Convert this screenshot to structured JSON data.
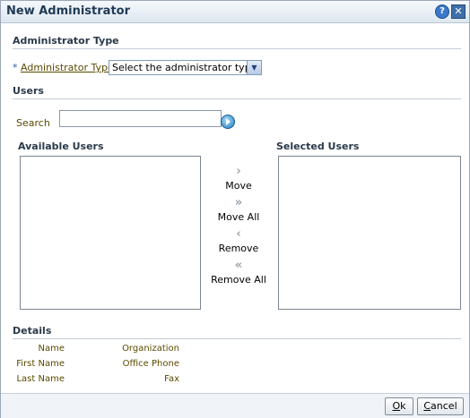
{
  "window": {
    "title": "New Administrator",
    "help_label": "?",
    "close_label": "✕"
  },
  "admin_type": {
    "header": "Administrator Type",
    "required_marker": "*",
    "field_label": "Administrator Type",
    "selected_value": "Select the administrator type"
  },
  "users": {
    "header": "Users",
    "search_label": "Search",
    "search_value": "",
    "available_header": "Available Users",
    "selected_header": "Selected Users",
    "available_items": [],
    "selected_items": []
  },
  "shuttle": {
    "move_label": "Move",
    "move_all_label": "Move All",
    "remove_label": "Remove",
    "remove_all_label": "Remove All",
    "move_icon": "›",
    "move_all_icon": "»",
    "remove_icon": "‹",
    "remove_all_icon": "«"
  },
  "details": {
    "header": "Details",
    "name_label": "Name",
    "first_name_label": "First Name",
    "last_name_label": "Last Name",
    "organization_label": "Organization",
    "office_phone_label": "Office Phone",
    "fax_label": "Fax"
  },
  "footer": {
    "ok_first": "O",
    "ok_rest": "k",
    "cancel_first": "C",
    "cancel_rest": "ancel"
  }
}
